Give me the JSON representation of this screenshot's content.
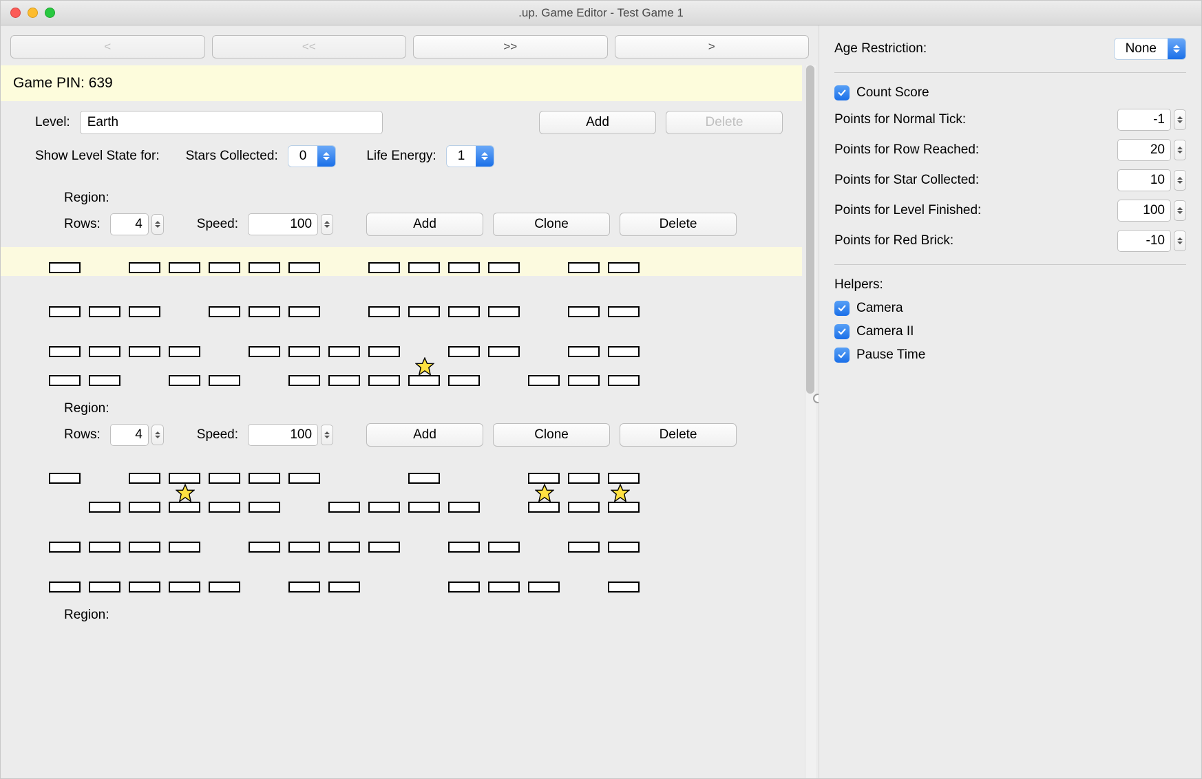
{
  "window": {
    "title": ".up. Game Editor - Test Game 1"
  },
  "nav": {
    "back": "<",
    "fastback": "<<",
    "fastfwd": ">>",
    "fwd": ">"
  },
  "pin_label": "Game PIN: 639",
  "level": {
    "label": "Level:",
    "value": "Earth",
    "add": "Add",
    "delete": "Delete",
    "show_state_label": "Show Level State for:",
    "stars_label": "Stars Collected:",
    "stars_value": "0",
    "life_label": "Life Energy:",
    "life_value": "1"
  },
  "regions": [
    {
      "label": "Region:",
      "rows_label": "Rows:",
      "rows_value": "4",
      "speed_label": "Speed:",
      "speed_value": "100",
      "add": "Add",
      "clone": "Clone",
      "delete": "Delete"
    },
    {
      "label": "Region:",
      "rows_label": "Rows:",
      "rows_value": "4",
      "speed_label": "Speed:",
      "speed_value": "100",
      "add": "Add",
      "clone": "Clone",
      "delete": "Delete"
    },
    {
      "label": "Region:"
    }
  ],
  "side": {
    "age_label": "Age Restriction:",
    "age_value": "None",
    "count_score": "Count Score",
    "rows": [
      {
        "label": "Points for Normal Tick:",
        "value": "-1"
      },
      {
        "label": "Points for Row Reached:",
        "value": "20"
      },
      {
        "label": "Points for Star Collected:",
        "value": "10"
      },
      {
        "label": "Points for Level Finished:",
        "value": "100"
      },
      {
        "label": "Points for Red Brick:",
        "value": "-10"
      }
    ],
    "helpers_label": "Helpers:",
    "helpers": [
      "Camera",
      "Camera II",
      "Pause Time"
    ]
  }
}
